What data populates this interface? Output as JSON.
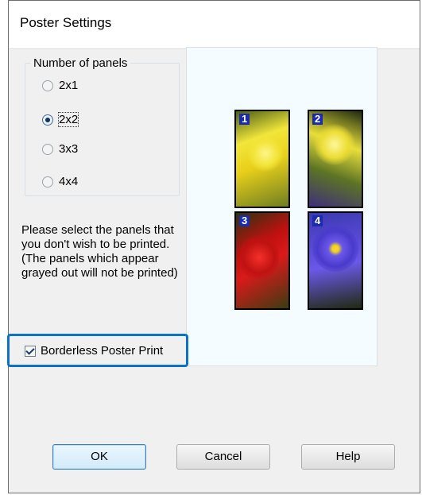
{
  "dialog": {
    "title": "Poster Settings"
  },
  "panels_group": {
    "label": "Number of panels",
    "options": [
      {
        "label": "2x1",
        "selected": false
      },
      {
        "label": "2x2",
        "selected": true
      },
      {
        "label": "3x3",
        "selected": false
      },
      {
        "label": "4x4",
        "selected": false
      }
    ]
  },
  "instructions": "Please select the panels that you don't wish to be printed. (The panels which appear grayed out will not be printed)",
  "preview": {
    "panel_numbers": [
      "1",
      "2",
      "3",
      "4"
    ]
  },
  "borderless": {
    "label": "Borderless Poster Print",
    "checked": true
  },
  "buttons": {
    "ok": "OK",
    "cancel": "Cancel",
    "help": "Help"
  },
  "colors": {
    "highlight": "#0b72c8",
    "panel_number_bg": "#1a2bb0",
    "preview_bg": "#f4fcff"
  }
}
